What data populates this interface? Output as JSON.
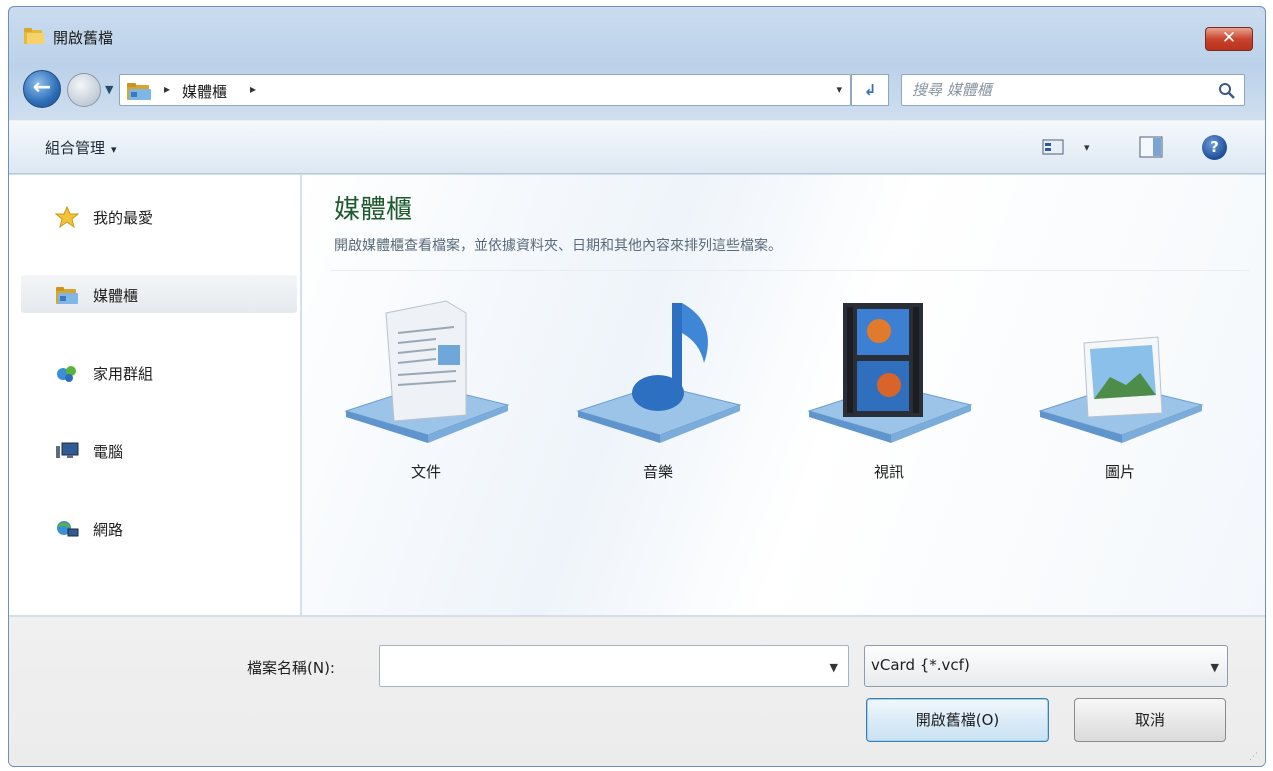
{
  "window": {
    "title": "開啟舊檔",
    "close_label": "✕"
  },
  "address": {
    "crumb": "媒體櫃",
    "separator": "▸",
    "dropdown": "▾",
    "refresh": "↲"
  },
  "search": {
    "placeholder": "搜尋 媒體櫃"
  },
  "toolbar": {
    "organize_label": "組合管理",
    "organize_caret": "▾",
    "views_caret": "▾",
    "help_label": "?"
  },
  "nav_pane": {
    "items": [
      {
        "label": "我的最愛",
        "icon": "star-icon"
      },
      {
        "label": "媒體櫃",
        "icon": "library-folder-icon",
        "selected": true
      },
      {
        "label": "家用群組",
        "icon": "homegroup-icon"
      },
      {
        "label": "電腦",
        "icon": "computer-icon"
      },
      {
        "label": "網路",
        "icon": "network-icon"
      }
    ]
  },
  "content": {
    "title": "媒體櫃",
    "description": "開啟媒體櫃查看檔案，並依據資料夾、日期和其他內容來排列這些檔案。",
    "libraries": [
      {
        "label": "文件",
        "icon": "documents-library-icon"
      },
      {
        "label": "音樂",
        "icon": "music-library-icon"
      },
      {
        "label": "視訊",
        "icon": "videos-library-icon"
      },
      {
        "label": "圖片",
        "icon": "pictures-library-icon"
      }
    ]
  },
  "bottom": {
    "filename_label": "檔案名稱(N):",
    "filename_value": "",
    "filetype_value": "vCard {*.vcf)",
    "open_button": "開啟舊檔(O)",
    "cancel_button": "取消"
  },
  "colors": {
    "title_green": "#1e5a2e",
    "frame_blue": "#bcd2ea",
    "close_red": "#c9442c"
  }
}
